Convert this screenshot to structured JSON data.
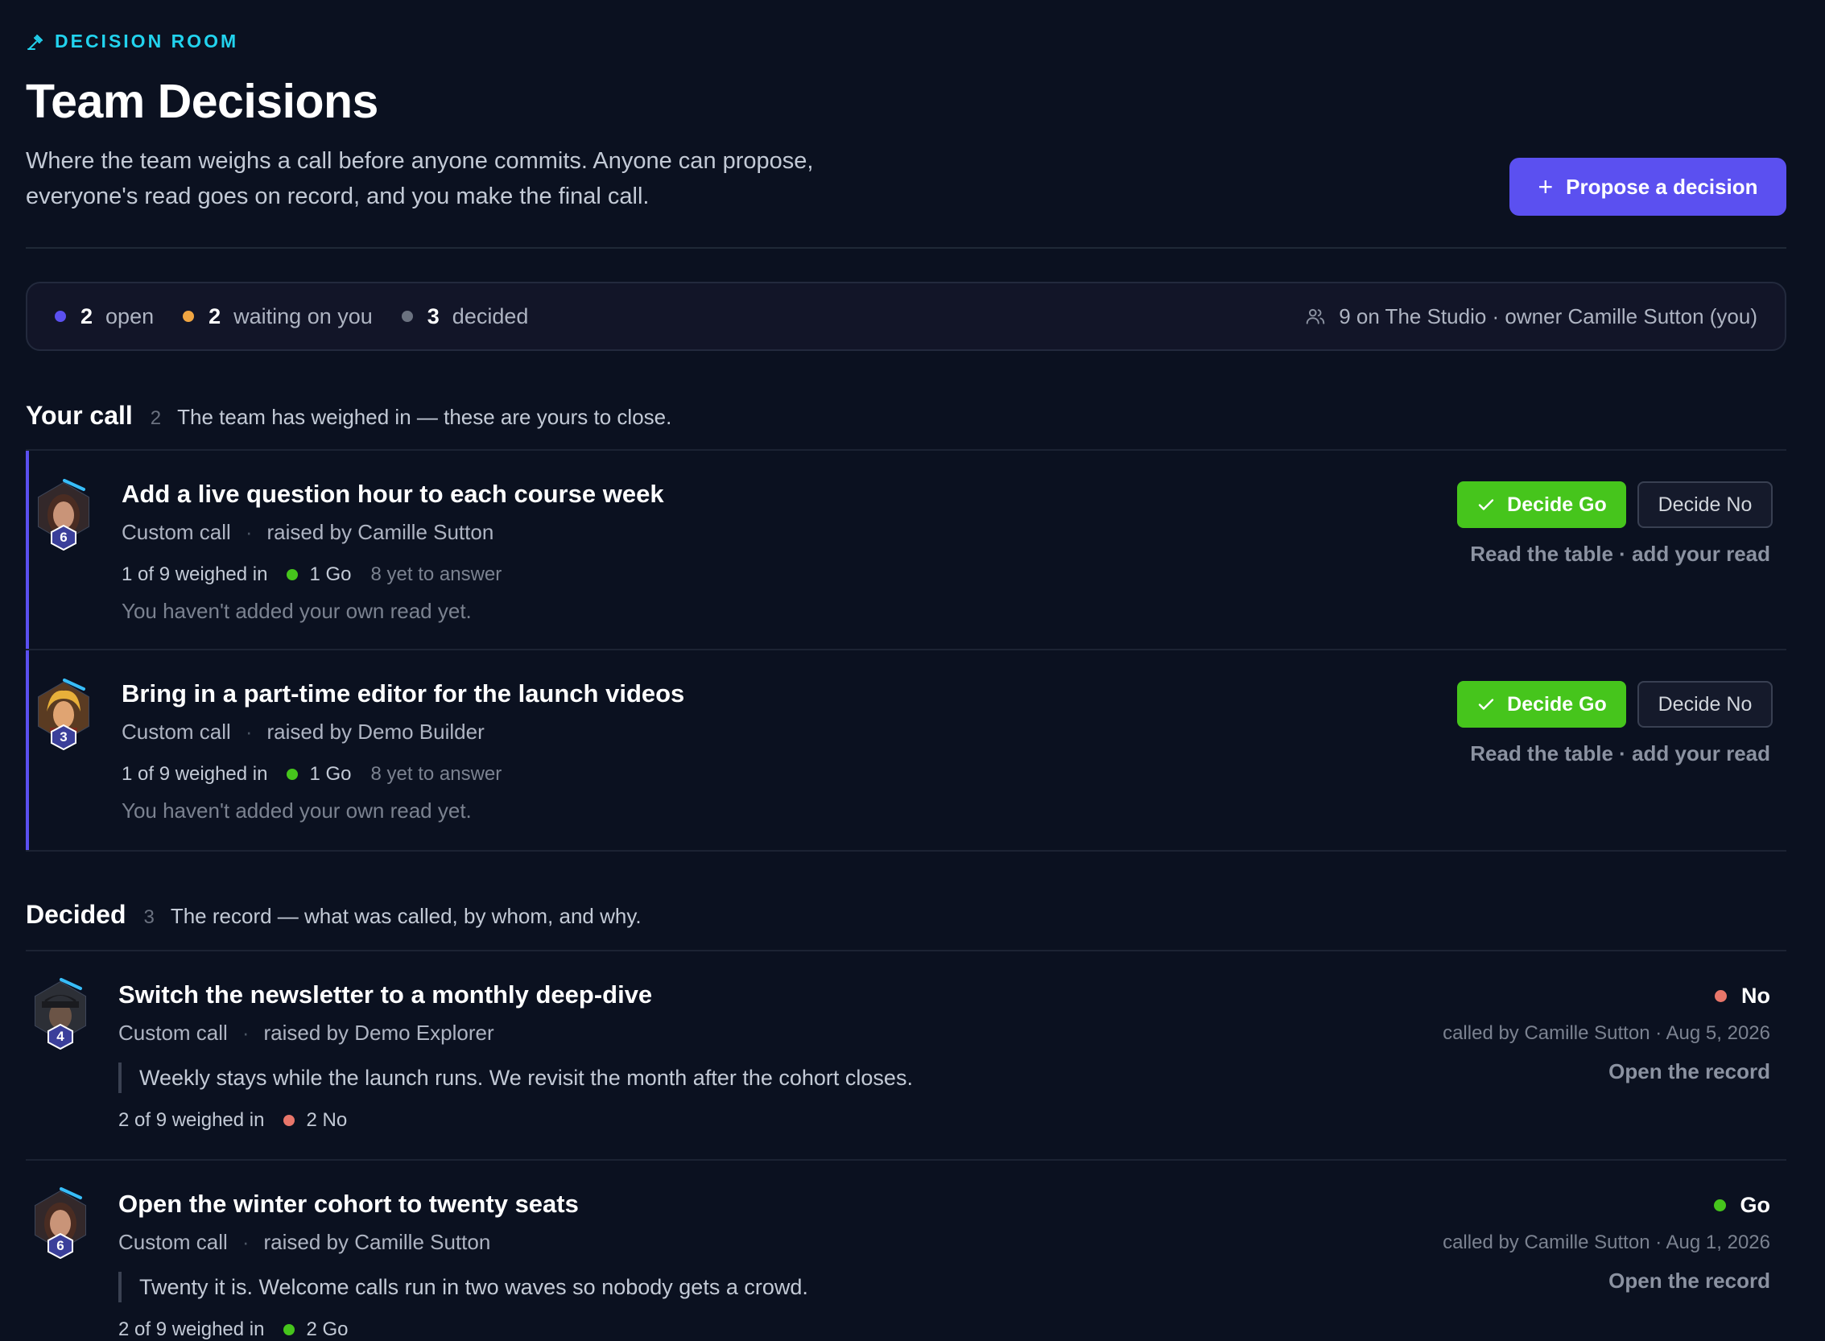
{
  "header": {
    "eyebrow": "DECISION ROOM",
    "title": "Team Decisions",
    "subtitle": "Where the team weighs a call before anyone commits. Anyone can propose, everyone's read goes on record, and you make the final call.",
    "propose_label": "Propose a decision"
  },
  "stats": {
    "open_count": "2",
    "open_label": "open",
    "waiting_count": "2",
    "waiting_label": "waiting on you",
    "decided_count": "3",
    "decided_label": "decided",
    "team_info": "9 on The Studio · owner Camille Sutton (you)"
  },
  "colors": {
    "accent": "#5b50f0",
    "go": "#46c51c",
    "no": "#e8766a",
    "waiting": "#f0a542",
    "decided": "#6b7280",
    "eyebrow": "#22d3ee"
  },
  "your_call": {
    "title": "Your call",
    "count": "2",
    "description": "The team has weighed in — these are yours to close.",
    "items": [
      {
        "title": "Add a live question hour to each course week",
        "type": "Custom call",
        "raised_by": "raised by Camille Sutton",
        "weighed": "1 of 9 weighed in",
        "vote": "1 Go",
        "pending": "8 yet to answer",
        "note": "You haven't added your own read yet.",
        "avatar_level": "6",
        "go_label": "Decide Go",
        "no_label": "Decide No",
        "link": "Read the table · add your read"
      },
      {
        "title": "Bring in a part-time editor for the launch videos",
        "type": "Custom call",
        "raised_by": "raised by Demo Builder",
        "weighed": "1 of 9 weighed in",
        "vote": "1 Go",
        "pending": "8 yet to answer",
        "note": "You haven't added your own read yet.",
        "avatar_level": "3",
        "go_label": "Decide Go",
        "no_label": "Decide No",
        "link": "Read the table · add your read"
      }
    ]
  },
  "decided": {
    "title": "Decided",
    "count": "3",
    "description": "The record — what was called, by whom, and why.",
    "items": [
      {
        "title": "Switch the newsletter to a monthly deep-dive",
        "type": "Custom call",
        "raised_by": "raised by Demo Explorer",
        "quote": "Weekly stays while the launch runs. We revisit the month after the cohort closes.",
        "weighed": "2 of 9 weighed in",
        "vote": "2 No",
        "verdict": "No",
        "called": "called by Camille Sutton · Aug 5, 2026",
        "link": "Open the record",
        "avatar_level": "4"
      },
      {
        "title": "Open the winter cohort to twenty seats",
        "type": "Custom call",
        "raised_by": "raised by Camille Sutton",
        "quote": "Twenty it is. Welcome calls run in two waves so nobody gets a crowd.",
        "weighed": "2 of 9 weighed in",
        "vote": "2 Go",
        "verdict": "Go",
        "called": "called by Camille Sutton · Aug 1, 2026",
        "link": "Open the record",
        "avatar_level": "6"
      }
    ]
  }
}
